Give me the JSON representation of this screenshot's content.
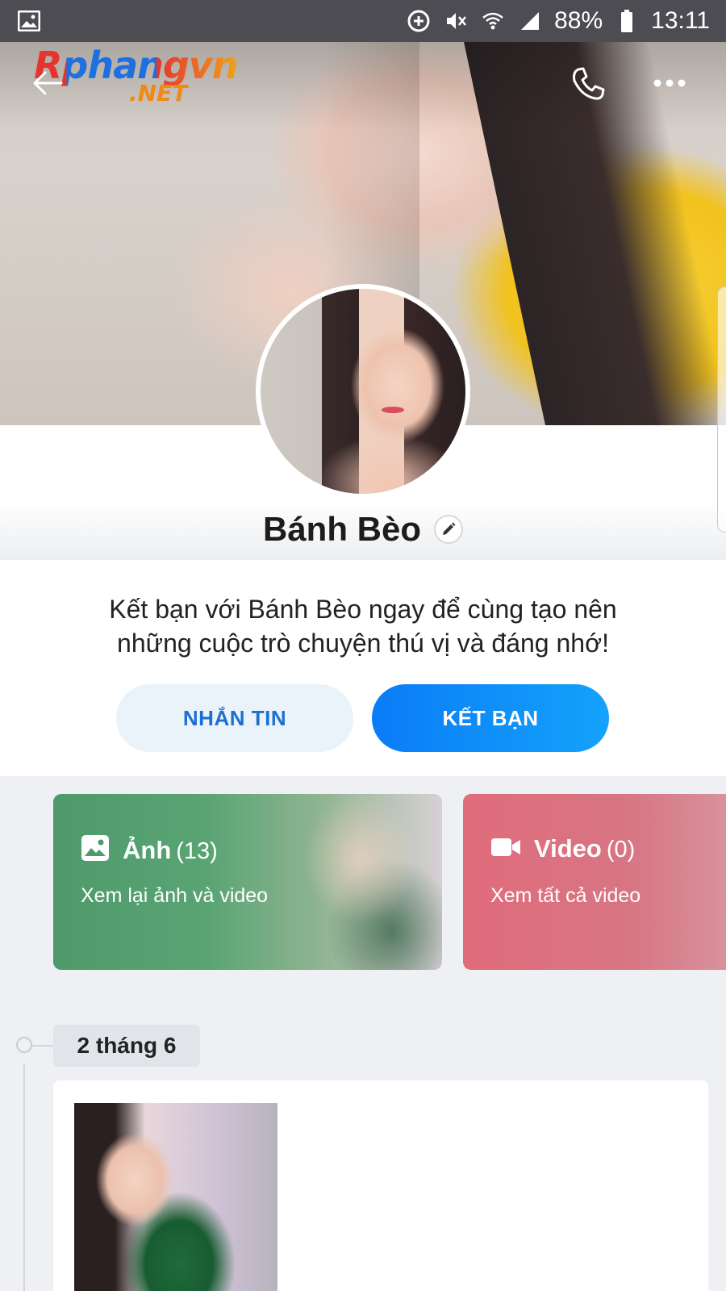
{
  "status_bar": {
    "battery": "88%",
    "time": "13:11",
    "icons": [
      "gallery-icon",
      "data-saver-icon",
      "mute-icon",
      "wifi-icon",
      "signal-icon",
      "battery-icon"
    ]
  },
  "watermark": {
    "main": "Rphangvn",
    "suffix": ".NET"
  },
  "nav": {
    "icons": [
      "back-arrow-icon",
      "phone-icon",
      "more-icon"
    ]
  },
  "profile": {
    "name": "Bánh Bèo"
  },
  "invite": {
    "text": "Kết bạn với Bánh Bèo ngay để cùng tạo nên những cuộc trò chuyện thú vị và đáng nhớ!",
    "message_button": "NHẮN TIN",
    "add_friend_button": "KẾT BẠN"
  },
  "media": {
    "photos": {
      "title": "Ảnh",
      "count": "(13)",
      "subtitle": "Xem lại ảnh và video"
    },
    "videos": {
      "title": "Video",
      "count": "(0)",
      "subtitle": "Xem tất cả video"
    }
  },
  "timeline": {
    "date": "2 tháng 6"
  },
  "colors": {
    "primary_blue": "#0a7cf7",
    "photos_card": "#4e9a6b",
    "videos_card": "#e06c7c",
    "status_bar": "#4c4c52"
  }
}
